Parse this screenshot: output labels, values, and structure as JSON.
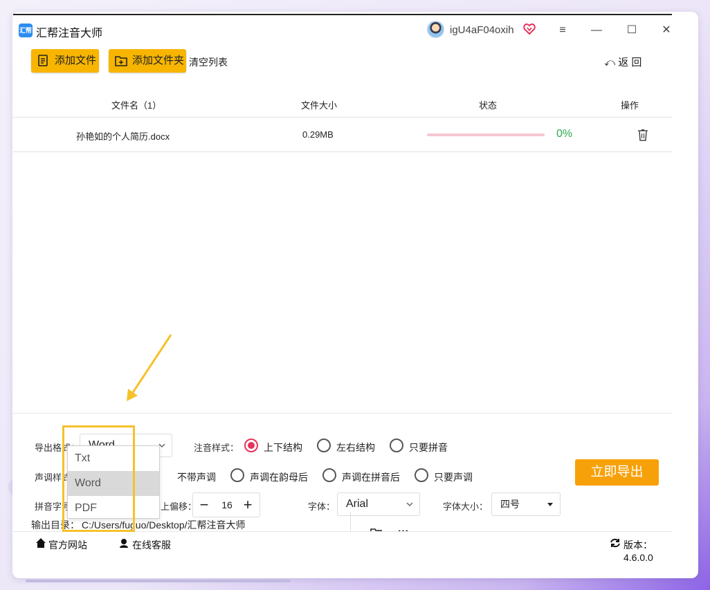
{
  "app": {
    "title": "汇帮注音大师",
    "logo_text": "汇帮",
    "username": "igU4aF04oxih",
    "window_controls": {
      "menu": "≡",
      "minimize": "—",
      "maximize": "☐",
      "close": "✕"
    }
  },
  "toolbar": {
    "add_file": "添加文件",
    "add_folder": "添加文件夹",
    "clear_list": "清空列表",
    "back": "返 回"
  },
  "table": {
    "headers": {
      "name": "文件名（1）",
      "size": "文件大小",
      "status": "状态",
      "action": "操作"
    },
    "rows": [
      {
        "name": "孙艳如的个人简历.docx",
        "size": "0.29MB",
        "progress": 0,
        "progress_text": "0%"
      }
    ]
  },
  "settings": {
    "export_format_label": "导出格式：",
    "export_format_value": "Word",
    "format_options": [
      "Txt",
      "Word",
      "PDF"
    ],
    "pinyin_style_label": "注音样式：",
    "pinyin_style_options": [
      "上下结构",
      "左右结构",
      "只要拼音"
    ],
    "pinyin_style_selected": "上下结构",
    "tone_style_label": "声调样式：",
    "tone_style_options": [
      "不带声调",
      "声调在韵母后",
      "声调在拼音后",
      "只要声调"
    ],
    "pinyin_font_label": "拼音字号：",
    "offset_label": "上偏移：",
    "offset_value": "16",
    "font_label": "字体：",
    "font_value": "Arial",
    "font_size_label": "字体大小：",
    "font_size_value": "四号",
    "output_dir_label": "输出目录：",
    "output_dir_value": "C:/Users/fuguo/Desktop/汇帮注音大师",
    "more": "···"
  },
  "export_button": "立即导出",
  "status_bar": {
    "official_site": "官方网站",
    "online_service": "在线客服",
    "version_label": "版本：",
    "version_value": "4.6.0.0"
  },
  "colors": {
    "accent": "#f7b500",
    "export": "#f7a10a",
    "radio_active": "#e8315b",
    "progress_text": "#2ea94e",
    "highlight": "#f6c12a"
  }
}
